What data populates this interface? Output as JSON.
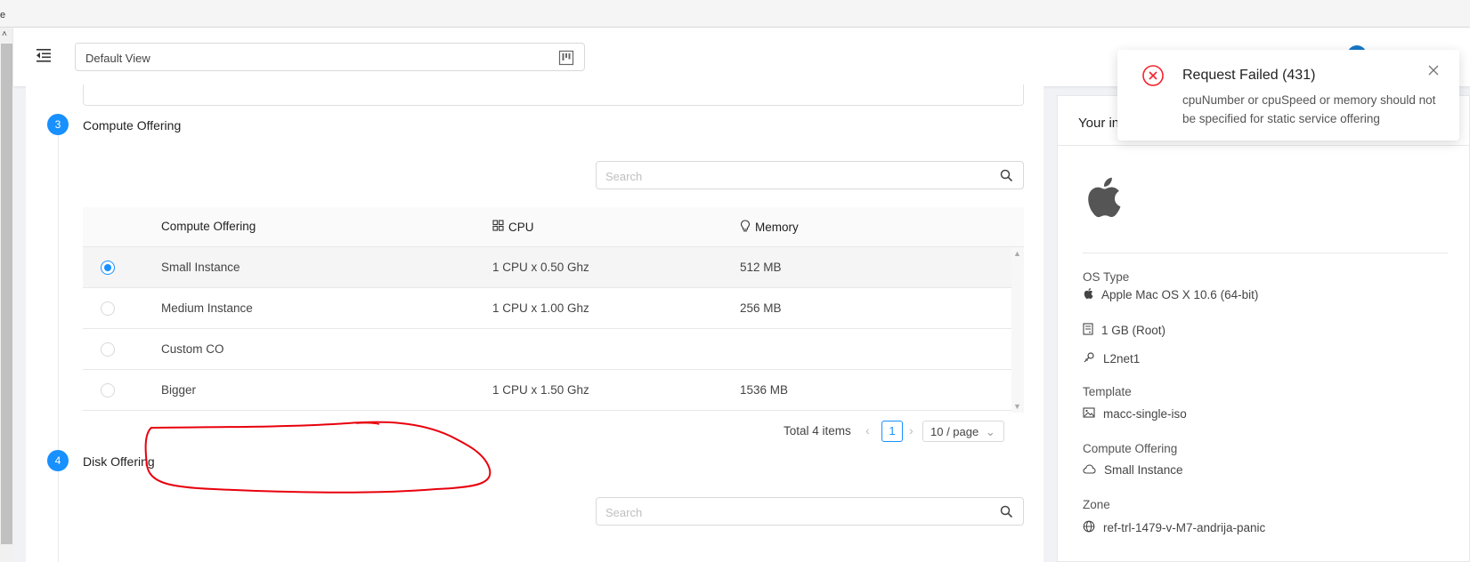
{
  "header": {
    "view_select_value": "Default View"
  },
  "steps": [
    {
      "number": "3",
      "title": "Compute Offering"
    },
    {
      "number": "4",
      "title": "Disk Offering"
    }
  ],
  "compute": {
    "search_placeholder": "Search",
    "columns": {
      "name": "Compute Offering",
      "cpu": "CPU",
      "memory": "Memory"
    },
    "rows": [
      {
        "name": "Small Instance",
        "cpu": "1 CPU x 0.50 Ghz",
        "memory": "512 MB",
        "selected": true
      },
      {
        "name": "Medium Instance",
        "cpu": "1 CPU x 1.00 Ghz",
        "memory": "256 MB",
        "selected": false
      },
      {
        "name": "Custom CO",
        "cpu": "",
        "memory": "",
        "selected": false
      },
      {
        "name": "Bigger",
        "cpu": "1 CPU x 1.50 Ghz",
        "memory": "1536 MB",
        "selected": false
      }
    ],
    "pagination": {
      "total": "Total 4 items",
      "current_page": "1",
      "page_size": "10 / page"
    }
  },
  "disk": {
    "search_placeholder": "Search"
  },
  "summary": {
    "header_title": "Your in",
    "os_type_label": "OS Type",
    "os_type_value": "Apple Mac OS X 10.6 (64-bit)",
    "disk_value": "1 GB (Root)",
    "network_value": "L2net1",
    "template_label": "Template",
    "template_value": "macc-single-iso",
    "compute_label": "Compute Offering",
    "compute_value": "Small Instance",
    "zone_label": "Zone",
    "zone_value": "ref-trl-1479-v-M7-andrija-panic"
  },
  "notification": {
    "title": "Request Failed (431)",
    "message": "cpuNumber or cpuSpeed or memory should not be specified for static service offering"
  },
  "colors": {
    "primary": "#1890ff",
    "error": "#f5222d",
    "annotation": "#e8000c"
  }
}
